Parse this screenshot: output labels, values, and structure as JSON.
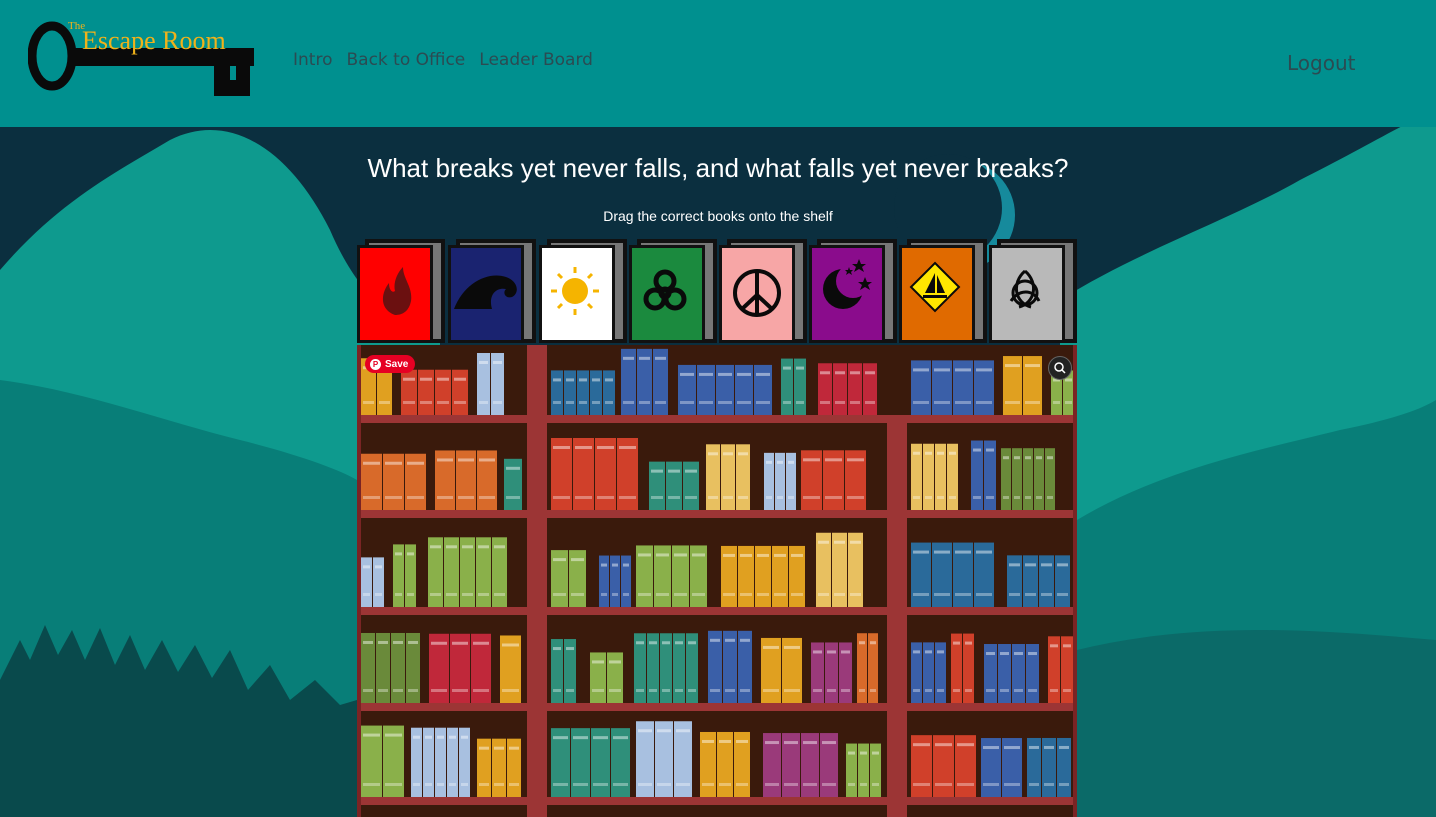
{
  "header": {
    "logo_small": "The",
    "logo_main": "Escape Room",
    "nav": [
      "Intro",
      "Back to Office",
      "Leader Board"
    ],
    "logout": "Logout"
  },
  "puzzle": {
    "question": "What breaks yet never falls, and what falls yet never breaks?",
    "instruction": "Drag the correct books onto the shelf"
  },
  "books": [
    {
      "symbol": "fire-icon",
      "color": "#ff0000"
    },
    {
      "symbol": "wave-icon",
      "color": "#1a2370"
    },
    {
      "symbol": "sun-icon",
      "color": "#ffffff"
    },
    {
      "symbol": "biohazard-icon",
      "color": "#1b8a3e"
    },
    {
      "symbol": "peace-icon",
      "color": "#f7a6a6"
    },
    {
      "symbol": "moon-stars-icon",
      "color": "#8a0c8c"
    },
    {
      "symbol": "sailboat-sign-icon",
      "color": "#e06a00"
    },
    {
      "symbol": "triquetra-icon",
      "color": "#b9b9b9"
    }
  ],
  "pin": {
    "save_label": "Save"
  },
  "colors": {
    "header": "#00908f",
    "night": "#0b2f3f",
    "mountain": "#0e9a8e",
    "shelf_wood": "#9c3535"
  }
}
